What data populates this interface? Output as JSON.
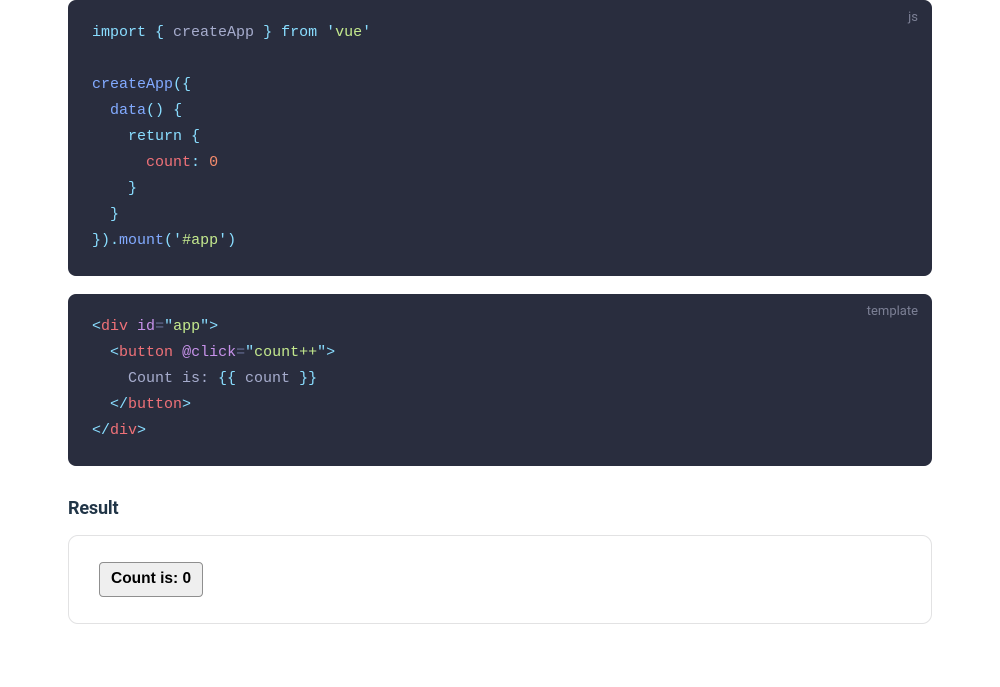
{
  "code_js": {
    "lang": "js",
    "tokens": [
      {
        "c": "tok-kw",
        "t": "import"
      },
      {
        "c": "tok-plain",
        "t": " "
      },
      {
        "c": "tok-punc",
        "t": "{"
      },
      {
        "c": "tok-plain",
        "t": " createApp "
      },
      {
        "c": "tok-punc",
        "t": "}"
      },
      {
        "c": "tok-plain",
        "t": " "
      },
      {
        "c": "tok-kw",
        "t": "from"
      },
      {
        "c": "tok-plain",
        "t": " "
      },
      {
        "c": "tok-punc",
        "t": "'"
      },
      {
        "c": "tok-str",
        "t": "vue"
      },
      {
        "c": "tok-punc",
        "t": "'"
      },
      {
        "c": null,
        "t": "\n"
      },
      {
        "c": null,
        "t": "\n"
      },
      {
        "c": "tok-fn",
        "t": "createApp"
      },
      {
        "c": "tok-punc",
        "t": "({"
      },
      {
        "c": null,
        "t": "\n"
      },
      {
        "c": "tok-plain",
        "t": "  "
      },
      {
        "c": "tok-fn",
        "t": "data"
      },
      {
        "c": "tok-punc",
        "t": "()"
      },
      {
        "c": "tok-plain",
        "t": " "
      },
      {
        "c": "tok-punc",
        "t": "{"
      },
      {
        "c": null,
        "t": "\n"
      },
      {
        "c": "tok-plain",
        "t": "    "
      },
      {
        "c": "tok-kw",
        "t": "return"
      },
      {
        "c": "tok-plain",
        "t": " "
      },
      {
        "c": "tok-punc",
        "t": "{"
      },
      {
        "c": null,
        "t": "\n"
      },
      {
        "c": "tok-plain",
        "t": "      "
      },
      {
        "c": "tok-prop",
        "t": "count"
      },
      {
        "c": "tok-punc",
        "t": ":"
      },
      {
        "c": "tok-plain",
        "t": " "
      },
      {
        "c": "tok-num",
        "t": "0"
      },
      {
        "c": null,
        "t": "\n"
      },
      {
        "c": "tok-plain",
        "t": "    "
      },
      {
        "c": "tok-punc",
        "t": "}"
      },
      {
        "c": null,
        "t": "\n"
      },
      {
        "c": "tok-plain",
        "t": "  "
      },
      {
        "c": "tok-punc",
        "t": "}"
      },
      {
        "c": null,
        "t": "\n"
      },
      {
        "c": "tok-punc",
        "t": "})."
      },
      {
        "c": "tok-fn",
        "t": "mount"
      },
      {
        "c": "tok-punc",
        "t": "("
      },
      {
        "c": "tok-punc",
        "t": "'"
      },
      {
        "c": "tok-str",
        "t": "#app"
      },
      {
        "c": "tok-punc",
        "t": "'"
      },
      {
        "c": "tok-punc",
        "t": ")"
      }
    ]
  },
  "code_template": {
    "lang": "template",
    "tokens": [
      {
        "c": "tok-punc",
        "t": "<"
      },
      {
        "c": "tok-tag",
        "t": "div"
      },
      {
        "c": "tok-plain",
        "t": " "
      },
      {
        "c": "tok-attr",
        "t": "id"
      },
      {
        "c": "tok-punc2",
        "t": "="
      },
      {
        "c": "tok-punc",
        "t": "\""
      },
      {
        "c": "tok-attrv",
        "t": "app"
      },
      {
        "c": "tok-punc",
        "t": "\""
      },
      {
        "c": "tok-punc",
        "t": ">"
      },
      {
        "c": null,
        "t": "\n"
      },
      {
        "c": "tok-plain",
        "t": "  "
      },
      {
        "c": "tok-punc",
        "t": "<"
      },
      {
        "c": "tok-tag",
        "t": "button"
      },
      {
        "c": "tok-plain",
        "t": " "
      },
      {
        "c": "tok-attr",
        "t": "@click"
      },
      {
        "c": "tok-punc2",
        "t": "="
      },
      {
        "c": "tok-punc",
        "t": "\""
      },
      {
        "c": "tok-attrv",
        "t": "count++"
      },
      {
        "c": "tok-punc",
        "t": "\""
      },
      {
        "c": "tok-punc",
        "t": ">"
      },
      {
        "c": null,
        "t": "\n"
      },
      {
        "c": "tok-plain",
        "t": "    Count is: "
      },
      {
        "c": "tok-punc",
        "t": "{{"
      },
      {
        "c": "tok-plain",
        "t": " count "
      },
      {
        "c": "tok-punc",
        "t": "}}"
      },
      {
        "c": null,
        "t": "\n"
      },
      {
        "c": "tok-plain",
        "t": "  "
      },
      {
        "c": "tok-punc",
        "t": "</"
      },
      {
        "c": "tok-tag",
        "t": "button"
      },
      {
        "c": "tok-punc",
        "t": ">"
      },
      {
        "c": null,
        "t": "\n"
      },
      {
        "c": "tok-punc",
        "t": "</"
      },
      {
        "c": "tok-tag",
        "t": "div"
      },
      {
        "c": "tok-punc",
        "t": ">"
      }
    ]
  },
  "result": {
    "title": "Result",
    "button_label": "Count is: 0"
  }
}
